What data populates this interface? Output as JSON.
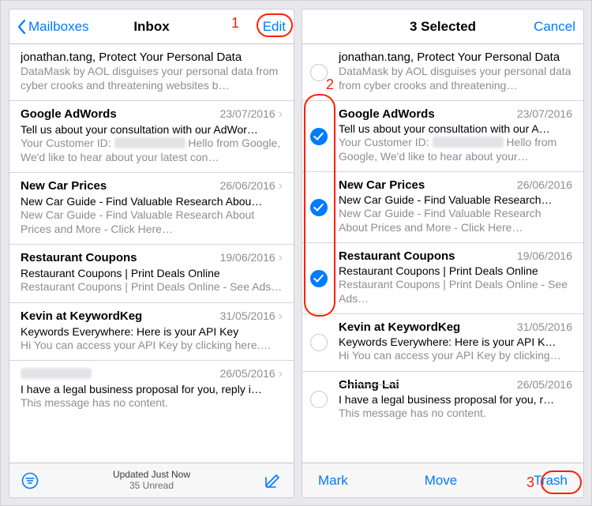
{
  "left": {
    "nav": {
      "back": "Mailboxes",
      "title": "Inbox",
      "edit": "Edit"
    },
    "status": {
      "line1": "Updated Just Now",
      "line2": "35 Unread"
    },
    "rows": [
      {
        "sender": "jonathan.tang, Protect Your Personal Data",
        "date": "",
        "subject": "DataMask by AOL disguises your personal data from cyber crooks and threatening websites b…",
        "preview": "",
        "first": true
      },
      {
        "sender": "Google AdWords",
        "date": "23/07/2016",
        "subject": "Tell us about your consultation with our AdWor…",
        "preview": "Your Customer ID: ██████  Hello from Google, We'd like to hear about your latest con…"
      },
      {
        "sender": "New Car Prices",
        "date": "26/06/2016",
        "subject": "New Car Guide - Find Valuable Research Abou…",
        "preview": "New Car Guide - Find Valuable Research About Prices and More - Click Here…"
      },
      {
        "sender": "Restaurant Coupons",
        "date": "19/06/2016",
        "subject": "Restaurant Coupons | Print Deals Online",
        "preview": "Restaurant Coupons | Print Deals Online - See Ads…"
      },
      {
        "sender": "Kevin at KeywordKeg",
        "date": "31/05/2016",
        "subject": "Keywords Everywhere: Here is your API Key",
        "preview": "Hi\nYou can access your API Key by clicking here.…"
      },
      {
        "sender": "██████",
        "date": "26/05/2016",
        "subject": "I have a legal business proposal for you, reply i…",
        "preview": "This message has no content."
      }
    ]
  },
  "right": {
    "nav": {
      "title": "3 Selected",
      "cancel": "Cancel"
    },
    "toolbar": {
      "mark": "Mark",
      "move": "Move",
      "trash": "Trash"
    },
    "rows": [
      {
        "selected": false,
        "sender": "jonathan.tang, Protect Your Personal Data",
        "date": "",
        "subject": "DataMask by AOL disguises your personal data from cyber crooks and threatening…",
        "preview": "",
        "first": true
      },
      {
        "selected": true,
        "sender": "Google AdWords",
        "date": "23/07/2016",
        "subject": "Tell us about your consultation with our A…",
        "preview": "Your Customer ID: ██████ Hello from Google, We'd like to hear about your…"
      },
      {
        "selected": true,
        "sender": "New Car Prices",
        "date": "26/06/2016",
        "subject": "New Car Guide - Find Valuable Research…",
        "preview": "New Car Guide - Find Valuable Research About Prices and More - Click Here…"
      },
      {
        "selected": true,
        "sender": "Restaurant Coupons",
        "date": "19/06/2016",
        "subject": "Restaurant Coupons | Print Deals Online",
        "preview": "Restaurant Coupons | Print Deals Online - See Ads…"
      },
      {
        "selected": false,
        "sender": "Kevin at KeywordKeg",
        "date": "31/05/2016",
        "subject": "Keywords Everywhere: Here is your API K…",
        "preview": "Hi\nYou can access your API Key by clicking…"
      },
      {
        "selected": false,
        "sender": "Chiang Lai",
        "date": "26/05/2016",
        "subject": "I have a legal business proposal for you, r…",
        "preview": "This message has no content."
      }
    ]
  },
  "annotations": {
    "n1": "1",
    "n2": "2",
    "n3": "3"
  }
}
